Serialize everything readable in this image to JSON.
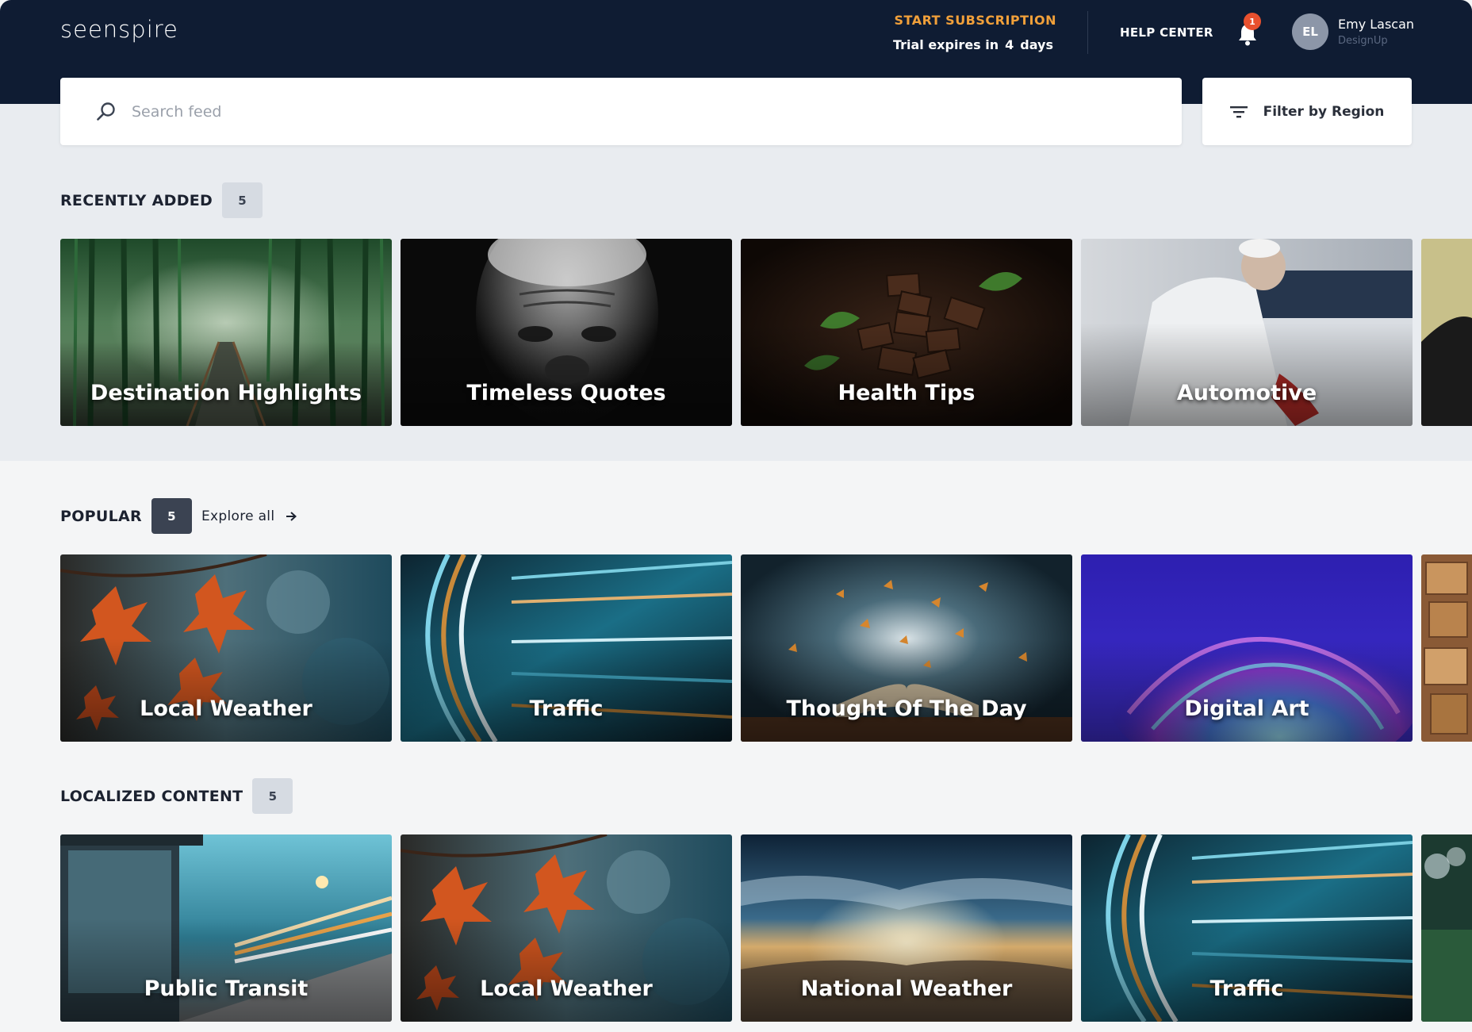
{
  "header": {
    "logo": "seenspire",
    "start_subscription": "START SUBSCRIPTION",
    "trial_prefix": "Trial expires in",
    "trial_days": "4",
    "trial_suffix": "days",
    "help_center": "HELP CENTER",
    "notification_count": "1",
    "user": {
      "initials": "EL",
      "name": "Emy Lascan",
      "org": "DesignUp"
    }
  },
  "search": {
    "placeholder": "Search feed",
    "value": ""
  },
  "filter": {
    "label": "Filter by Region"
  },
  "sections": [
    {
      "title": "RECENTLY ADDED",
      "count": "5",
      "cards": [
        {
          "label": "Destination Highlights",
          "theme": "bamboo-forest"
        },
        {
          "label": "Timeless Quotes",
          "theme": "bw-portrait"
        },
        {
          "label": "Health Tips",
          "theme": "chocolate"
        },
        {
          "label": "Automotive",
          "theme": "mechanic"
        },
        {
          "label": "",
          "theme": "partial-olive"
        }
      ]
    },
    {
      "title": "POPULAR",
      "count": "5",
      "explore": "Explore all",
      "cards": [
        {
          "label": "Local Weather",
          "theme": "autumn-leaves"
        },
        {
          "label": "Traffic",
          "theme": "light-trails"
        },
        {
          "label": "Thought Of The Day",
          "theme": "butterflies-book"
        },
        {
          "label": "Digital Art",
          "theme": "blue-purple-swirl"
        },
        {
          "label": "",
          "theme": "partial-blocks"
        }
      ]
    },
    {
      "title": "LOCALIZED CONTENT",
      "count": "5",
      "cards": [
        {
          "label": "Public Transit",
          "theme": "bus-stop"
        },
        {
          "label": "Local Weather",
          "theme": "autumn-leaves"
        },
        {
          "label": "National Weather",
          "theme": "sunrise-clouds"
        },
        {
          "label": "Traffic",
          "theme": "light-trails"
        },
        {
          "label": "",
          "theme": "partial-bokeh"
        }
      ]
    }
  ],
  "colors": {
    "header_bg": "#0f1c33",
    "accent_orange": "#f1a03a",
    "badge_red": "#e8502e",
    "page_bg": "#f4f5f6",
    "band_bg": "#e9ecf0"
  }
}
